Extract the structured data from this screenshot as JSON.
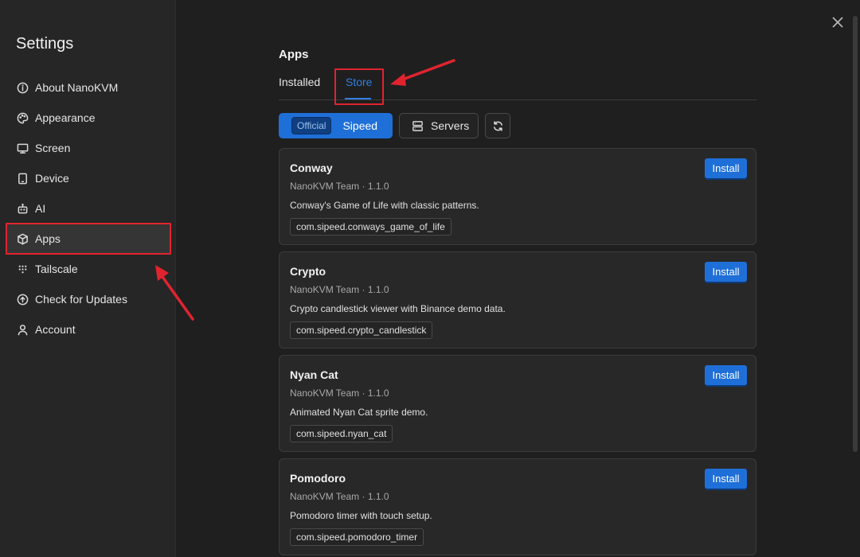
{
  "sidebar": {
    "title": "Settings",
    "items": [
      {
        "label": "About NanoKVM",
        "icon": "info-icon"
      },
      {
        "label": "Appearance",
        "icon": "palette-icon"
      },
      {
        "label": "Screen",
        "icon": "monitor-icon"
      },
      {
        "label": "Device",
        "icon": "device-icon"
      },
      {
        "label": "AI",
        "icon": "robot-icon"
      },
      {
        "label": "Apps",
        "icon": "package-icon",
        "active": true
      },
      {
        "label": "Tailscale",
        "icon": "tailscale-icon"
      },
      {
        "label": "Check for Updates",
        "icon": "arrow-up-circle-icon"
      },
      {
        "label": "Account",
        "icon": "user-icon"
      }
    ]
  },
  "main": {
    "title": "Apps",
    "tabs": [
      {
        "label": "Installed"
      },
      {
        "label": "Store",
        "active": true
      }
    ],
    "source": {
      "badge": "Official",
      "label": "Sipeed"
    },
    "servers_label": "Servers",
    "cards": [
      {
        "name": "Conway",
        "meta": "NanoKVM Team · 1.1.0",
        "description": "Conway's Game of Life with classic patterns.",
        "id": "com.sipeed.conways_game_of_life",
        "button": "Install"
      },
      {
        "name": "Crypto",
        "meta": "NanoKVM Team · 1.1.0",
        "description": "Crypto candlestick viewer with Binance demo data.",
        "id": "com.sipeed.crypto_candlestick",
        "button": "Install"
      },
      {
        "name": "Nyan Cat",
        "meta": "NanoKVM Team · 1.1.0",
        "description": "Animated Nyan Cat sprite demo.",
        "id": "com.sipeed.nyan_cat",
        "button": "Install"
      },
      {
        "name": "Pomodoro",
        "meta": "NanoKVM Team · 1.1.0",
        "description": "Pomodoro timer with touch setup.",
        "id": "com.sipeed.pomodoro_timer",
        "button": "Install"
      }
    ]
  },
  "colors": {
    "accent": "#1f6fd8",
    "annotation": "#e0242f"
  }
}
